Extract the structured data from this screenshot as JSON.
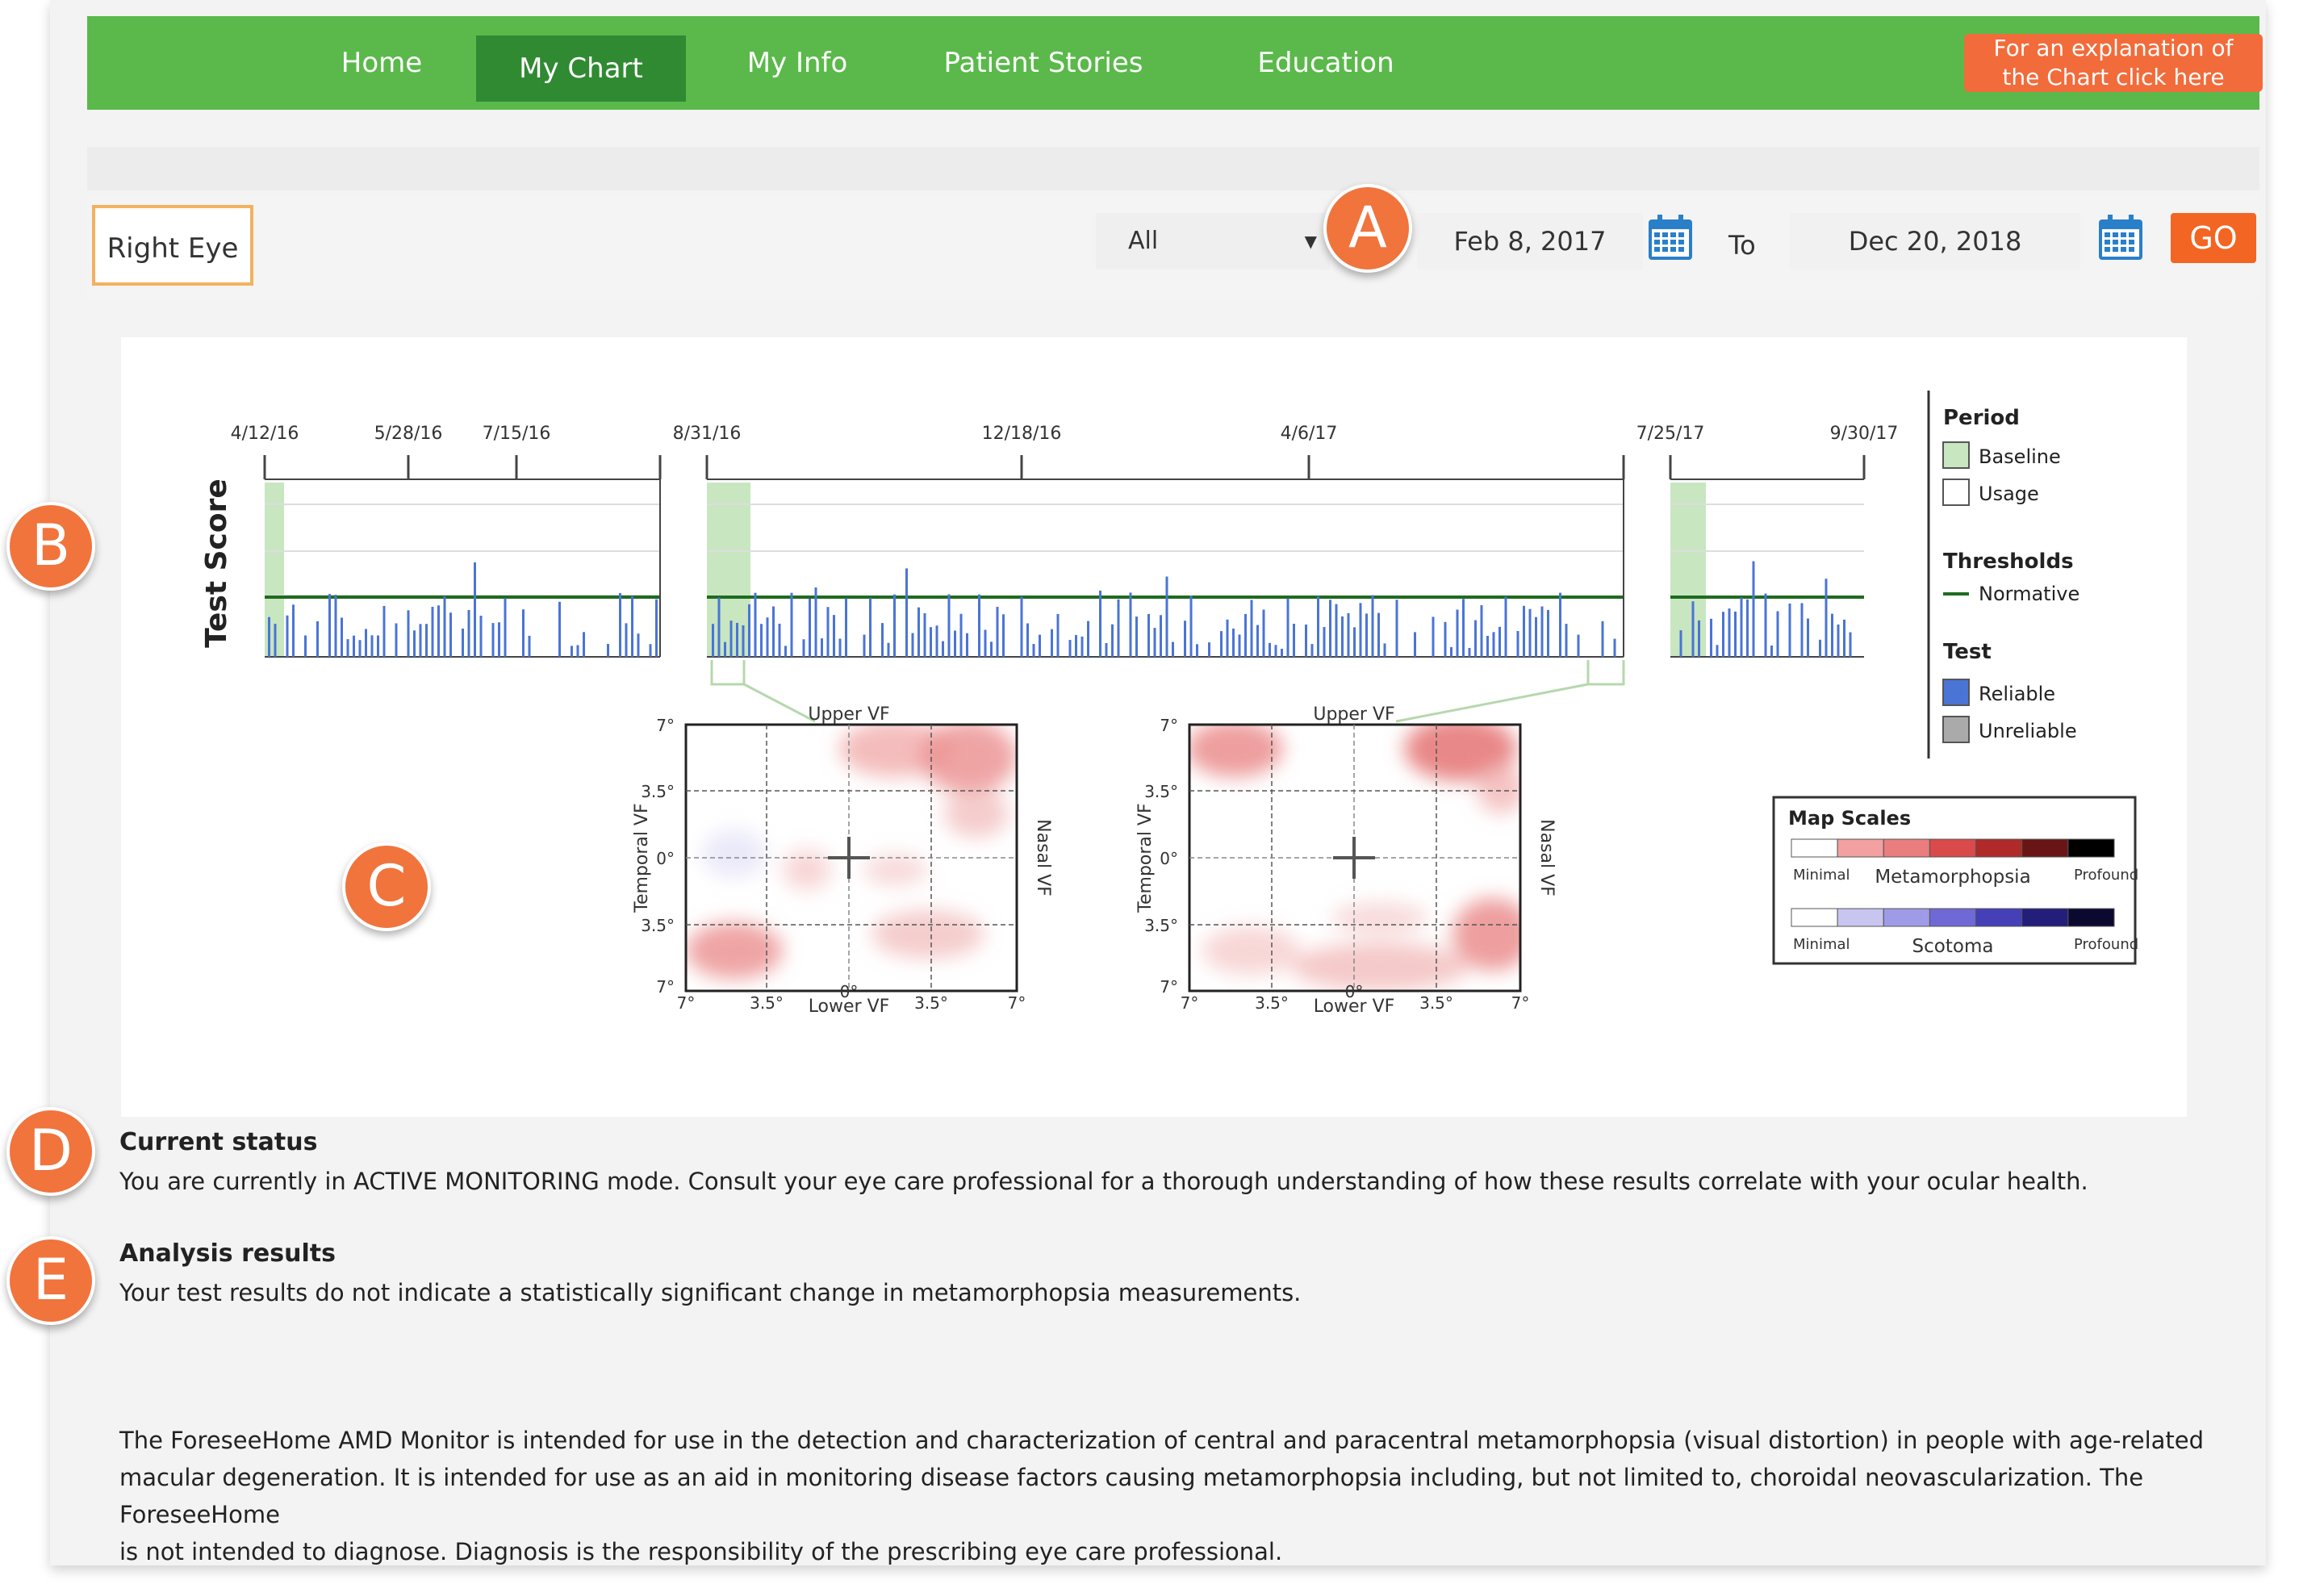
{
  "nav": {
    "items": [
      {
        "label": "Home"
      },
      {
        "label": "My Chart"
      },
      {
        "label": "My Info"
      },
      {
        "label": "Patient Stories"
      },
      {
        "label": "Education"
      }
    ],
    "active": "My Chart",
    "explain_line1": "For an explanation of",
    "explain_line2": "the Chart click here"
  },
  "controls": {
    "eye": "Right Eye",
    "filter": "All",
    "date_from": "Feb 8, 2017",
    "to_label": "To",
    "date_to": "Dec 20, 2018",
    "go_label": "GO"
  },
  "markers": {
    "a": "A",
    "b": "B",
    "c": "C",
    "d": "D",
    "e": "E"
  },
  "chart": {
    "ylabel": "Test Score",
    "date_ticks": [
      "4/12/16",
      "5/28/16",
      "7/15/16",
      "8/31/16",
      "12/18/16",
      "4/6/17",
      "7/25/17",
      "9/30/17"
    ],
    "legend": {
      "period_title": "Period",
      "baseline": "Baseline",
      "usage": "Usage",
      "thresholds_title": "Thresholds",
      "normative": "Normative",
      "test_title": "Test",
      "reliable": "Reliable",
      "unreliable": "Unreliable"
    },
    "map_scales": {
      "title": "Map Scales",
      "minimal": "Minimal",
      "profound": "Profound",
      "metamorphopsia": "Metamorphopsia",
      "scotoma": "Scotoma",
      "meta_colors": [
        "#ffffff",
        "#f2a0a0",
        "#ea7d7d",
        "#d94a4a",
        "#b02a2a",
        "#6a1515",
        "#000000"
      ],
      "scotoma_colors": [
        "#ffffff",
        "#c8c6f0",
        "#9f9be6",
        "#6f69d6",
        "#4540b8",
        "#221e7a",
        "#0b0930"
      ]
    },
    "vf_maps": {
      "upper": "Upper VF",
      "lower": "Lower VF",
      "temporal": "Temporal VF",
      "nasal": "Nasal VF",
      "y_ticks": [
        "7°",
        "3.5°",
        "0°",
        "3.5°",
        "7°"
      ],
      "x_ticks": [
        "7°",
        "3.5°",
        "0°",
        "3.5°",
        "7°"
      ]
    }
  },
  "status": {
    "heading": "Current status",
    "body": "You are currently in ACTIVE MONITORING mode. Consult your eye care professional for a thorough understanding of how these results correlate with your ocular health."
  },
  "analysis": {
    "heading": "Analysis results",
    "body": "Your test results do not indicate a statistically significant change in metamorphopsia measurements."
  },
  "disclaimer": {
    "line1": "The ForeseeHome AMD Monitor is intended for use in the detection and characterization of central and paracentral metamorphopsia (visual distortion) in people with age-related",
    "line2": "macular degeneration. It is intended for use as an aid in monitoring disease factors causing metamorphopsia including, but not limited to, choroidal neovascularization. The ForeseeHome",
    "line3": "is not intended to diagnose. Diagnosis is the responsibility of the prescribing eye care professional."
  },
  "colors": {
    "nav_bg": "#5ab94a",
    "nav_active": "#2f8a32",
    "accent": "#f26522",
    "bar_reliable": "#4a74d6",
    "baseline_fill": "#c8e6c0",
    "normative_line": "#1f6b1f"
  }
}
